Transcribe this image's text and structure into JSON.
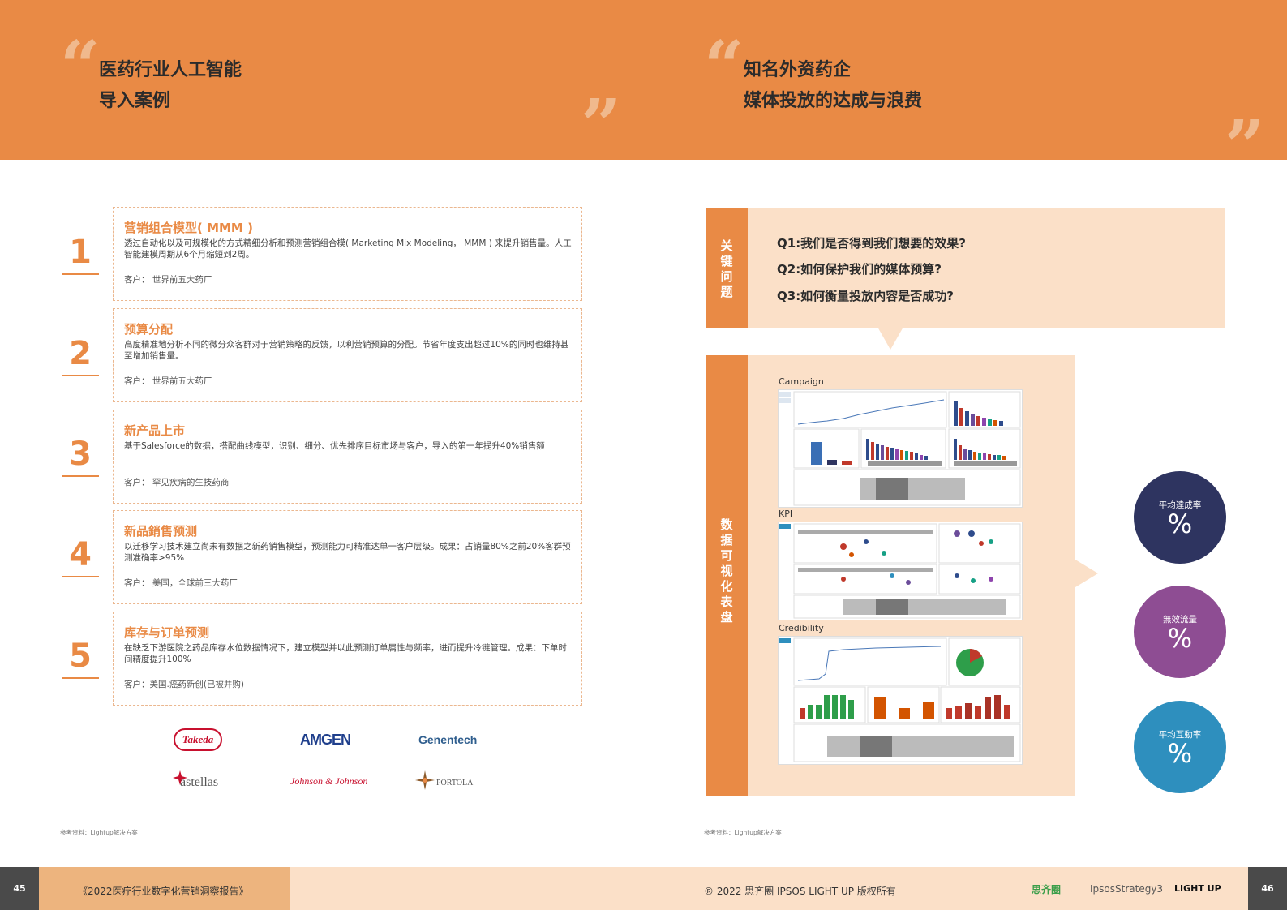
{
  "header": {
    "left_title_1": "医药行业人工智能",
    "left_title_2": "导入案例",
    "right_title_1": "知名外资药企",
    "right_title_2": "媒体投放的达成与浪费",
    "open_quote": "“",
    "close_quote": "”"
  },
  "cases": [
    {
      "num": "1",
      "title": "营销组合模型( MMM )",
      "desc": "透过自动化以及可规模化的方式精细分析和预测营销组合模( Marketing Mix Modeling， MMM ) 来提升销售量。人工智能建模周期从6个月缩短到2周。",
      "client": "客户： 世界前五大药厂"
    },
    {
      "num": "2",
      "title": "预算分配",
      "desc": "高度精准地分析不同的微分众客群对于营销策略的反馈，以利营销预算的分配。节省年度支出超过10%的同时也维持甚至增加销售量。",
      "client": "客户： 世界前五大药厂"
    },
    {
      "num": "3",
      "title": "新产品上市",
      "desc": "基于Salesforce的数据，搭配曲线模型，识别、细分、优先排序目标市场与客户，导入的第一年提升40%销售额",
      "client": "客户： 罕见疾病的生技药商"
    },
    {
      "num": "4",
      "title": "新品銷售预测",
      "desc": "以迁移学习技术建立尚未有数据之新药销售模型，预测能力可精准达单一客户层级。成果：占销量80%之前20%客群预测准确率>95%",
      "client": "客户： 美国，全球前三大药厂"
    },
    {
      "num": "5",
      "title": "库存与订单预测",
      "desc": "在缺乏下游医院之药品库存水位数据情况下，建立模型并以此预测订单属性与频率，进而提升冷链管理。成果：下单时间精度提升100%",
      "client": "客户：美国.癌药新创(已被并购)"
    }
  ],
  "logos": [
    "Takeda",
    "AMGEN",
    "Genentech",
    "astellas",
    "Johnson & Johnson",
    "PORTOLA"
  ],
  "source_left": "参考资料：Lightup解决方案",
  "source_right": "参考资料：Lightup解决方案",
  "questions": {
    "side_label": [
      "关",
      "键",
      "问",
      "题"
    ],
    "items": [
      "Q1:我们是否得到我们想要的效果?",
      "Q2:如何保护我们的媒体预算?",
      "Q3:如何衡量投放内容是否成功?"
    ]
  },
  "dashboard": {
    "side_label": [
      "数",
      "据",
      "可",
      "视",
      "化",
      "表",
      "盘"
    ],
    "labels": [
      "Campaign",
      "KPI",
      "Credibility"
    ]
  },
  "metrics": [
    {
      "label": "平均達成率",
      "value": "%",
      "color": "#2E3460"
    },
    {
      "label": "無效流量",
      "value": "%",
      "color": "#8E4D93"
    },
    {
      "label": "平均互動率",
      "value": "%",
      "color": "#2E8FBE"
    }
  ],
  "footer": {
    "page_left": "45",
    "page_right": "46",
    "report_title": "《2022医疗行业数字化营销洞察报告》",
    "copyright": "® 2022 思齐圈 IPSOS LIGHT UP 版权所有",
    "brand_1": "思齐圈",
    "brand_2": "IpsosStrategy3",
    "brand_3": "LIGHT UP"
  }
}
